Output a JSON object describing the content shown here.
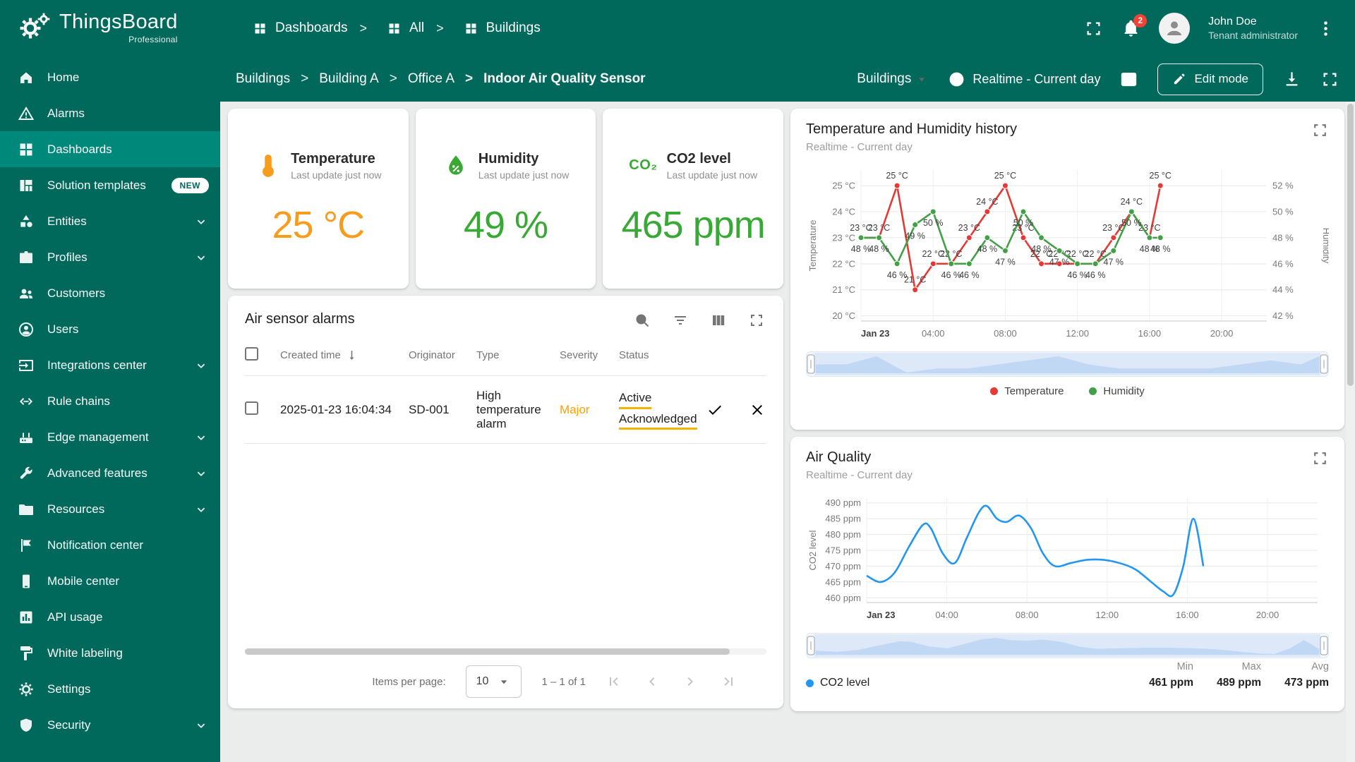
{
  "colors": {
    "brand_teal": "#00695c",
    "sidebar_selected": "#00897b",
    "badge_red": "#f44336",
    "temperature_accent": "#f89c1c",
    "humidity_accent": "#39a935",
    "co2_accent": "#39a935",
    "severity_major": "#ffa000",
    "status_underline": "#f2b600",
    "series_temperature": "#e53935",
    "series_humidity": "#43a047",
    "series_co2": "#2196f3"
  },
  "app": {
    "brand": "ThingsBoard",
    "brand_sub": "Professional",
    "top_breadcrumb": [
      "Dashboards",
      "All",
      "Buildings"
    ],
    "notifications_count": "2",
    "user": {
      "name": "John Doe",
      "role": "Tenant administrator"
    }
  },
  "toolbar": {
    "breadcrumb": [
      "Buildings",
      "Building A",
      "Office A",
      "Indoor Air Quality Sensor"
    ],
    "state_select": "Buildings",
    "time_window": "Realtime - Current day",
    "edit_button": "Edit mode"
  },
  "sidebar": {
    "items": [
      {
        "label": "Home",
        "icon": "home"
      },
      {
        "label": "Alarms",
        "icon": "warning"
      },
      {
        "label": "Dashboards",
        "icon": "dashboards",
        "selected": true
      },
      {
        "label": "Solution templates",
        "icon": "templates",
        "badge": "NEW"
      },
      {
        "label": "Entities",
        "icon": "entities",
        "expandable": true
      },
      {
        "label": "Profiles",
        "icon": "profiles",
        "expandable": true
      },
      {
        "label": "Customers",
        "icon": "customers"
      },
      {
        "label": "Users",
        "icon": "users"
      },
      {
        "label": "Integrations center",
        "icon": "integrations",
        "expandable": true
      },
      {
        "label": "Rule chains",
        "icon": "rule-chains"
      },
      {
        "label": "Edge management",
        "icon": "edge",
        "expandable": true
      },
      {
        "label": "Advanced features",
        "icon": "advanced",
        "expandable": true
      },
      {
        "label": "Resources",
        "icon": "resources",
        "expandable": true
      },
      {
        "label": "Notification center",
        "icon": "flag"
      },
      {
        "label": "Mobile center",
        "icon": "mobile"
      },
      {
        "label": "API usage",
        "icon": "api"
      },
      {
        "label": "White labeling",
        "icon": "paint"
      },
      {
        "label": "Settings",
        "icon": "settings"
      },
      {
        "label": "Security",
        "icon": "security",
        "expandable": true
      }
    ]
  },
  "cards": {
    "temperature": {
      "title": "Temperature",
      "subtitle": "Last update just now",
      "value": "25 °C",
      "color": "#f89c1c"
    },
    "humidity": {
      "title": "Humidity",
      "subtitle": "Last update just now",
      "value": "49 %",
      "color": "#39a935"
    },
    "co2": {
      "title": "CO2 level",
      "subtitle": "Last update just now",
      "value": "465 ppm",
      "color": "#39a935",
      "icon_text": "CO₂"
    }
  },
  "alarms": {
    "title": "Air sensor alarms",
    "columns": [
      "Created time",
      "Originator",
      "Type",
      "Severity",
      "Status"
    ],
    "rows": [
      {
        "created_time": "2025-01-23 16:04:34",
        "originator": "SD-001",
        "type": "High temperature alarm",
        "severity": "Major",
        "severity_color": "#ffa000",
        "status_line1": "Active",
        "status_line2": "Acknowledged"
      }
    ],
    "items_per_page_label": "Items per page:",
    "items_per_page": "10",
    "range_label": "1 – 1 of 1"
  },
  "chart_data": [
    {
      "type": "line",
      "title": "Temperature and Humidity history",
      "subtitle": "Realtime - Current day",
      "x_domain": [
        0,
        22.5
      ],
      "x_ticks": [
        {
          "v": 0,
          "label": "Jan 23",
          "bold": true
        },
        {
          "v": 4,
          "label": "04:00"
        },
        {
          "v": 8,
          "label": "08:00"
        },
        {
          "v": 12,
          "label": "12:00"
        },
        {
          "v": 16,
          "label": "16:00"
        },
        {
          "v": 20,
          "label": "20:00"
        }
      ],
      "y_axis": {
        "label": "Temperature",
        "unit": "°C",
        "ticks": [
          20,
          21,
          22,
          23,
          24,
          25
        ],
        "domain": [
          19.8,
          25.6
        ]
      },
      "y2_axis": {
        "label": "Humidity",
        "unit": "%",
        "ticks": [
          42,
          44,
          46,
          48,
          50,
          52
        ],
        "domain": [
          41.6,
          53.2
        ]
      },
      "x": [
        0,
        1,
        2,
        3,
        4,
        5,
        6,
        7,
        8,
        9,
        10,
        11,
        12,
        13,
        14,
        15,
        16,
        16.6
      ],
      "series": [
        {
          "name": "Temperature",
          "color": "#e53935",
          "axis": "y",
          "unit": "°C",
          "markers": true,
          "labels": true,
          "values": [
            23,
            23,
            25,
            21,
            22,
            22,
            23,
            24,
            25,
            23,
            22,
            22,
            22,
            22,
            23,
            24,
            23,
            25
          ]
        },
        {
          "name": "Humidity",
          "color": "#43a047",
          "axis": "y2",
          "unit": "%",
          "markers": true,
          "labels": true,
          "values": [
            48,
            48,
            46,
            49,
            50,
            46,
            46,
            48,
            47,
            50,
            48,
            47,
            46,
            46,
            47,
            50,
            48,
            48
          ]
        }
      ],
      "legend": [
        "Temperature",
        "Humidity"
      ]
    },
    {
      "type": "line",
      "title": "Air Quality",
      "subtitle": "Realtime - Current day",
      "x_domain": [
        0,
        22.5
      ],
      "x_ticks": [
        {
          "v": 0,
          "label": "Jan 23",
          "bold": true
        },
        {
          "v": 4,
          "label": "04:00"
        },
        {
          "v": 8,
          "label": "08:00"
        },
        {
          "v": 12,
          "label": "12:00"
        },
        {
          "v": 16,
          "label": "16:00"
        },
        {
          "v": 20,
          "label": "20:00"
        }
      ],
      "y_axis": {
        "label": "CO2 level",
        "unit": "ppm",
        "ticks": [
          460,
          465,
          470,
          475,
          480,
          485,
          490
        ],
        "domain": [
          458.5,
          491.5
        ]
      },
      "x": [
        0,
        0.7,
        1.4,
        2.1,
        2.8,
        3.2,
        3.8,
        4.4,
        5.0,
        5.6,
        6.0,
        6.5,
        7.0,
        7.6,
        8.2,
        8.8,
        9.4,
        10.2,
        11.0,
        11.8,
        12.6,
        13.4,
        14.2,
        14.8,
        15.3,
        15.8,
        16.3,
        16.8
      ],
      "series": [
        {
          "name": "CO2 level",
          "color": "#2196f3",
          "axis": "y",
          "unit": "ppm",
          "smooth": true,
          "values": [
            467,
            465,
            468,
            476,
            483,
            482,
            474,
            471,
            479,
            487,
            489,
            485,
            484,
            486,
            482,
            474,
            470,
            471,
            472,
            472,
            471,
            469,
            465,
            462,
            461,
            470,
            485,
            470
          ]
        }
      ],
      "legend": [
        "CO2 level"
      ],
      "stats": {
        "headers": [
          "Min",
          "Max",
          "Avg"
        ],
        "values": [
          "461 ppm",
          "489 ppm",
          "473 ppm"
        ]
      }
    }
  ]
}
